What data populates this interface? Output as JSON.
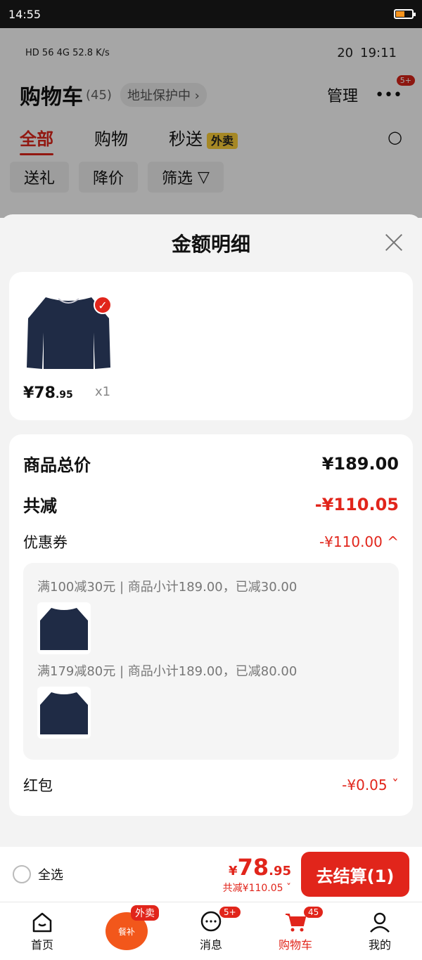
{
  "status_bar": {
    "time": "14:55"
  },
  "inner_status": {
    "left": "HD 56 4G 52.8 K/s",
    "time": "19:11",
    "battery": "20"
  },
  "cart_header": {
    "title": "购物车",
    "count": "(45)",
    "address": "地址保护中 ›",
    "manage": "管理",
    "badge": "5+"
  },
  "tabs": [
    {
      "label": "全部"
    },
    {
      "label": "购物"
    },
    {
      "label": "秒送"
    }
  ],
  "takeout_tag": "外卖",
  "chips": [
    {
      "label": "送礼"
    },
    {
      "label": "降价"
    },
    {
      "label": "筛选"
    }
  ],
  "sheet": {
    "title": "金额明细",
    "product": {
      "price_main": "¥78",
      "price_cents": ".95",
      "qty": "x1"
    },
    "total_label": "商品总价",
    "total_value": "¥189.00",
    "reduce_label": "共减",
    "reduce_value": "-¥110.05",
    "coupon_label": "优惠券",
    "coupon_value": "-¥110.00 ^",
    "coupons": [
      {
        "text": "满100减30元 | 商品小计189.00，已减30.00"
      },
      {
        "text": "满179减80元 | 商品小计189.00，已减80.00"
      }
    ],
    "redpack_label": "红包",
    "redpack_value": "-¥0.05 ˇ"
  },
  "bottom": {
    "select_all": "全选",
    "total_main": "78",
    "total_cents": ".95",
    "yen": "¥",
    "saved": "共减¥110.05 ˇ",
    "checkout": "去结算(1)"
  },
  "nav": {
    "items": [
      {
        "label": "首页"
      },
      {
        "label": ""
      },
      {
        "label": "消息"
      },
      {
        "label": "购物车"
      },
      {
        "label": "我的"
      }
    ],
    "promo_tag": "外卖",
    "promo_text": "餐补",
    "msg_badge": "5+",
    "cart_badge": "45"
  }
}
